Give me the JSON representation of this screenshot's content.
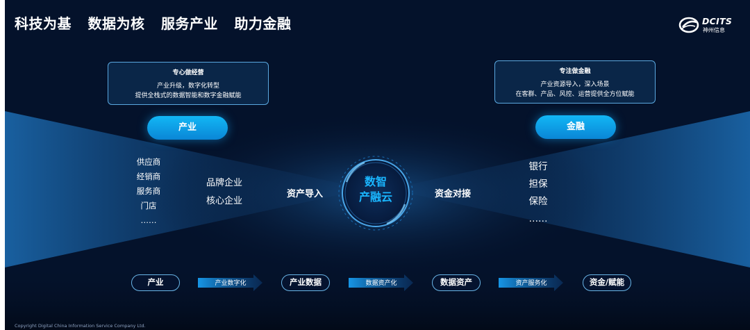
{
  "title": {
    "parts": [
      "科技为基",
      "数据为核",
      "服务产业",
      "助力金融"
    ]
  },
  "logo": {
    "brand": "DCITS",
    "subtitle": "神州信息"
  },
  "left_box": {
    "title": "专心做经营",
    "lines": [
      "产业升级，数字化转型",
      "提供全栈式的数据智能和数字金融赋能"
    ]
  },
  "right_box": {
    "title": "专注做金融",
    "lines": [
      "产业资源导入，深入场景",
      "在客群、产品、风控、运营提供全方位赋能"
    ]
  },
  "left_pill": "产业",
  "right_pill": "金融",
  "industry_list": [
    "供应商",
    "经销商",
    "服务商",
    "门店",
    "……"
  ],
  "core_list": [
    "品牌企业",
    "核心企业"
  ],
  "finance_list": [
    "银行",
    "担保",
    "保险",
    "……"
  ],
  "connector_left": "资产导入",
  "connector_right": "资金对接",
  "hub": {
    "line1": "数智",
    "line2": "产融云"
  },
  "flow": {
    "nodes": [
      "产业",
      "产业数据",
      "数据资产",
      "资金/赋能"
    ],
    "arrows": [
      "产业数字化",
      "数据资产化",
      "资产服务化"
    ]
  },
  "footer": "Copyright  Digital China Information Service Company Ltd.",
  "colors": {
    "background": "#04122b",
    "accent": "#12b7f5",
    "hub_text": "#1ab6ff",
    "box_border": "#5aa8e0"
  }
}
